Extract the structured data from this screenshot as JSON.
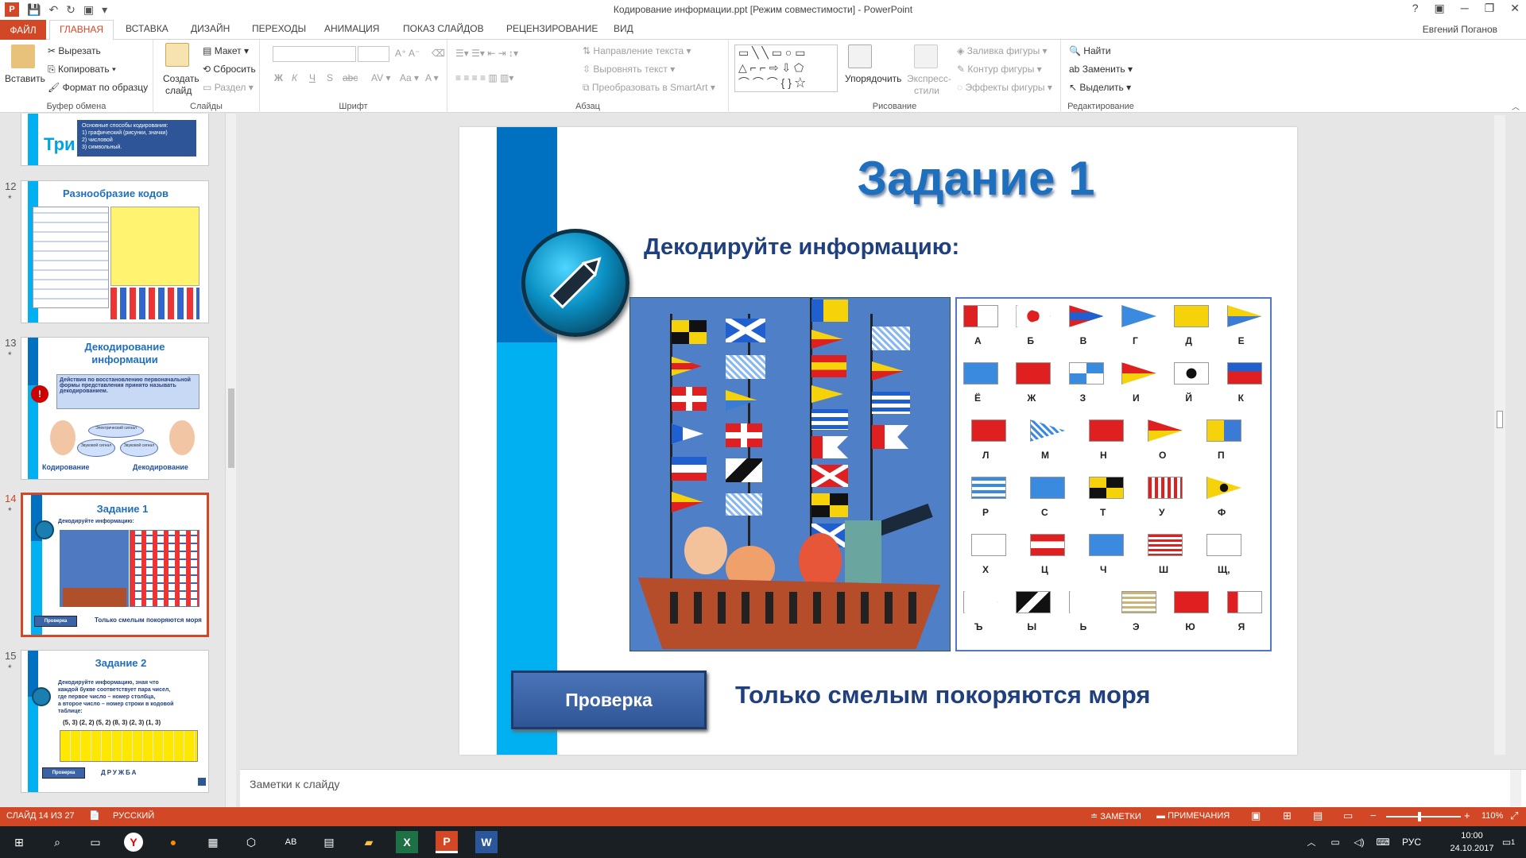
{
  "window": {
    "title": "Кодирование информации.ppt [Режим совместимости] - PowerPoint",
    "user": "Евгений Поганов",
    "app_logo": "P"
  },
  "menu": {
    "file": "ФАЙЛ",
    "tabs": [
      "ГЛАВНАЯ",
      "ВСТАВКА",
      "ДИЗАЙН",
      "ПЕРЕХОДЫ",
      "АНИМАЦИЯ",
      "ПОКАЗ СЛАЙДОВ",
      "РЕЦЕНЗИРОВАНИЕ",
      "ВИД"
    ]
  },
  "ribbon": {
    "clipboard": {
      "paste": "Вставить",
      "cut": "Вырезать",
      "copy": "Копировать",
      "format_painter": "Формат по образцу",
      "label": "Буфер обмена"
    },
    "slides": {
      "new_slide_1": "Создать",
      "new_slide_2": "слайд",
      "layout": "Макет",
      "reset": "Сбросить",
      "section": "Раздел",
      "label": "Слайды"
    },
    "font": {
      "bold": "Ж",
      "italic": "К",
      "underline": "Ч",
      "shadow": "S",
      "strike": "abc",
      "label": "Шрифт"
    },
    "paragraph": {
      "text_direction": "Направление текста",
      "align_text": "Выровнять текст",
      "smartart": "Преобразовать в SmartArt",
      "label": "Абзац"
    },
    "drawing": {
      "arrange": "Упорядочить",
      "quick_styles_1": "Экспресс-",
      "quick_styles_2": "стили",
      "fill": "Заливка фигуры",
      "outline": "Контур фигуры",
      "effects": "Эффекты фигуры",
      "label": "Рисование"
    },
    "editing": {
      "find": "Найти",
      "replace": "Заменить",
      "select": "Выделить",
      "label": "Редактирование"
    }
  },
  "thumbnails": [
    {
      "num": "",
      "title": "",
      "body_lines": [
        "Основные способы кодирования:",
        "1) графический (рисунки, значки)",
        "2) числовой",
        "3) символьный."
      ],
      "big": "Три"
    },
    {
      "num": "12",
      "star": "*",
      "title": "Разнообразие кодов"
    },
    {
      "num": "13",
      "star": "*",
      "title_1": "Декодирование",
      "title_2": "информации",
      "body": "Действия по восстановлению первоначальной формы представления принято называть декодированием.",
      "bubble_1": "Электрический сигнал",
      "bubble_2": "Звуковой сигнал",
      "bubble_3": "Звуковой сигнал",
      "caption_1": "Кодирование",
      "caption_2": "Декодирование"
    },
    {
      "num": "14",
      "star": "*",
      "title": "Задание 1",
      "subtitle": "Декодируйте информацию:",
      "button": "Проверка",
      "caption": "Только смелым покоряются моря"
    },
    {
      "num": "15",
      "star": "*",
      "title": "Задание 2",
      "body_1": "Декодируйте информацию, зная что",
      "body_2": "каждой букве соответствует пара чисел,",
      "body_3": "где первое число – номер столбца,",
      "body_4": "а второе число – номер строки в кодовой",
      "body_5": "таблице:",
      "code": "(5, 3) (2, 2) (5, 2) (8, 3) (2, 3) (1, 3)",
      "button": "Проверка",
      "answer": "ДРУЖБА"
    }
  ],
  "slide": {
    "title": "Задание 1",
    "subtitle": "Декодируйте информацию:",
    "button": "Проверка",
    "answer": "Только смелым покоряются моря",
    "flag_letters": [
      [
        "А",
        "Б",
        "В",
        "Г",
        "Д",
        "Е"
      ],
      [
        "Ё",
        "Ж",
        "З",
        "И",
        "Й",
        "К"
      ],
      [
        "Л",
        "М",
        "Н",
        "О",
        "П"
      ],
      [
        "Р",
        "С",
        "Т",
        "У",
        "Ф"
      ],
      [
        "Х",
        "Ц",
        "Ч",
        "Ш",
        "Щ,"
      ],
      [
        "Ъ",
        "Ы",
        "Ь",
        "Э",
        "Ю",
        "Я"
      ]
    ]
  },
  "notes": {
    "placeholder": "Заметки к слайду"
  },
  "status": {
    "slide": "СЛАЙД 14 ИЗ 27",
    "lang": "РУССКИЙ",
    "notes": "ЗАМЕТКИ",
    "comments": "ПРИМЕЧАНИЯ",
    "zoom": "110%"
  },
  "taskbar": {
    "lang": "РУС",
    "time": "10:00",
    "date": "24.10.2017",
    "notif": "1"
  },
  "colors": {
    "accent": "#d24726",
    "slide_blue": "#0070c0",
    "slide_cyan": "#00b0f0",
    "title_blue": "#1f6fbf",
    "button": "#3a64a5"
  }
}
